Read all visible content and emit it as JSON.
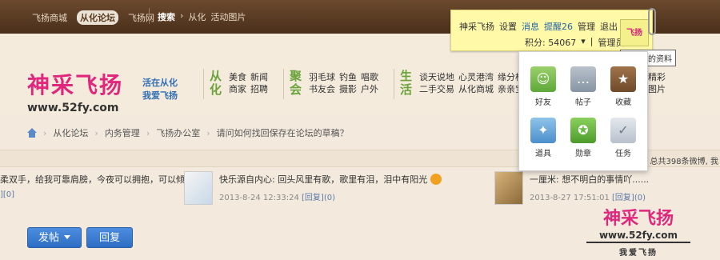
{
  "topbar": {
    "nav": [
      "飞扬商城",
      "从化论坛",
      "飞扬网"
    ],
    "search": "搜索",
    "crumb_arrow": "›",
    "crumbs": [
      "从化",
      "活动图片"
    ]
  },
  "user": {
    "name": "神采飞扬",
    "links": [
      "设置",
      "消息",
      "提醒26",
      "管理",
      "退出"
    ],
    "points_label": "积分: 54067",
    "role": "管理员",
    "avatar_text": "飞扬",
    "tooltip": "查看我的资料"
  },
  "logo": {
    "cn": "神采飞扬",
    "url": "www.52fy.com"
  },
  "slogan": [
    "活在从化",
    "我爱飞扬"
  ],
  "categories": [
    {
      "head": "从化",
      "color": "#6aa33a",
      "items": [
        "美食",
        "新闻",
        "商家",
        "招聘"
      ]
    },
    {
      "head": "聚会",
      "color": "#6aa33a",
      "items": [
        "羽毛球",
        "钓鱼",
        "唱歌",
        "书友会",
        "摄影",
        "户外"
      ]
    },
    {
      "head": "生活",
      "color": "#6aa33a",
      "items": [
        "谈天说地",
        "心灵港湾",
        "缘分桥",
        "二手交易",
        "从化商城",
        "亲亲宝贝"
      ]
    },
    {
      "head": "",
      "color": "#6aa33a",
      "items": [
        "精彩",
        "图片"
      ]
    }
  ],
  "breadcrumb": [
    "从化论坛",
    "内务管理",
    "飞扬办公室",
    "请问如何找回保存在论坛的草稿？"
  ],
  "stats": "总共398条微博, 我",
  "feed": [
    {
      "text": "柔双手，给我可靠肩膀，今夜可以拥抱，可以倾",
      "meta": "",
      "link": "]",
      "link2": "[0]"
    },
    {
      "text": "快乐源自内心: 回头风里有歌，歌里有泪，泪中有阳光",
      "time": "2013-8-24 12:33:24",
      "reply": "[回复]",
      "count": "(0)"
    },
    {
      "text": "一厘米: 想不明白的事情吖......",
      "time": "2013-8-27 17:51:01",
      "reply": "[回复]",
      "count": "(0)"
    }
  ],
  "buttons": {
    "post": "发帖",
    "reply": "回复"
  },
  "popup": [
    {
      "label": "好友",
      "glyph": "☺"
    },
    {
      "label": "帖子",
      "glyph": "…"
    },
    {
      "label": "收藏",
      "glyph": "★"
    },
    {
      "label": "道具",
      "glyph": "✦"
    },
    {
      "label": "勋章",
      "glyph": "✪"
    },
    {
      "label": "任务",
      "glyph": "✓"
    }
  ],
  "watermark": {
    "cn": "神采飞扬",
    "url": "www.52fy.com",
    "sub": "我爱飞扬"
  }
}
